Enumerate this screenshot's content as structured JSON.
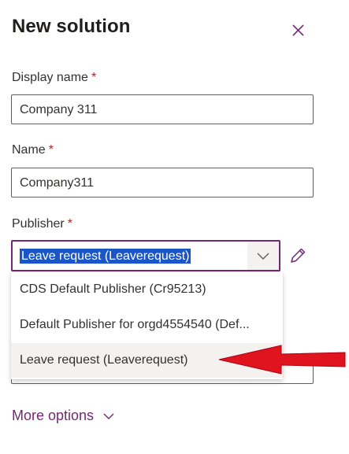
{
  "header": {
    "title": "New solution",
    "close_icon": "close-icon"
  },
  "fields": {
    "display_name": {
      "label": "Display name",
      "required_mark": "*",
      "value": "Company 311"
    },
    "name": {
      "label": "Name",
      "required_mark": "*",
      "value": "Company311"
    },
    "publisher": {
      "label": "Publisher",
      "required_mark": "*",
      "selected": "Leave request (Leaverequest)",
      "edit_icon": "pencil-icon",
      "chevron_icon": "chevron-down-icon"
    }
  },
  "publisher_options": [
    {
      "label": "CDS Default Publisher (Cr95213)"
    },
    {
      "label": "Default Publisher for orgd4554540 (Def..."
    },
    {
      "label": "Leave request (Leaverequest)"
    }
  ],
  "more_options": {
    "label": "More options",
    "icon": "chevron-down-icon"
  },
  "annotation": {
    "arrow_color": "#e0141e"
  },
  "colors": {
    "accent": "#742774",
    "selection": "#1a56c7",
    "required": "#a4262c"
  }
}
